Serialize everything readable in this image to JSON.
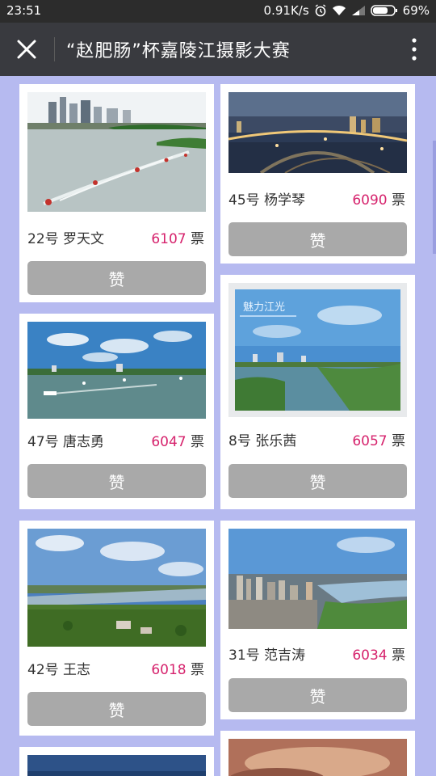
{
  "status": {
    "time": "23:51",
    "speed": "0.91K/s",
    "battery": "69%"
  },
  "nav": {
    "title": "“赵肥肠”杯嘉陵江摄影大赛"
  },
  "entries": [
    {
      "num": "22号",
      "name": "罗天文",
      "votes": "6107",
      "unit": "票",
      "button": "赞"
    },
    {
      "num": "45号",
      "name": "杨学琴",
      "votes": "6090",
      "unit": "票",
      "button": "赞"
    },
    {
      "num": "47号",
      "name": "唐志勇",
      "votes": "6047",
      "unit": "票",
      "button": "赞"
    },
    {
      "num": "8号",
      "name": "张乐茜",
      "votes": "6057",
      "unit": "票",
      "button": "赞"
    },
    {
      "num": "42号",
      "name": "王志",
      "votes": "6018",
      "unit": "票",
      "button": "赞"
    },
    {
      "num": "31号",
      "name": "范吉涛",
      "votes": "6034",
      "unit": "票",
      "button": "赞"
    }
  ],
  "photo_texts": {
    "overlay_8": "魅力江光"
  },
  "colors": {
    "background": "#b6baf0",
    "vote_number": "#d6236d",
    "like_button": "#a9a9a9",
    "navbar": "#393a3f"
  }
}
